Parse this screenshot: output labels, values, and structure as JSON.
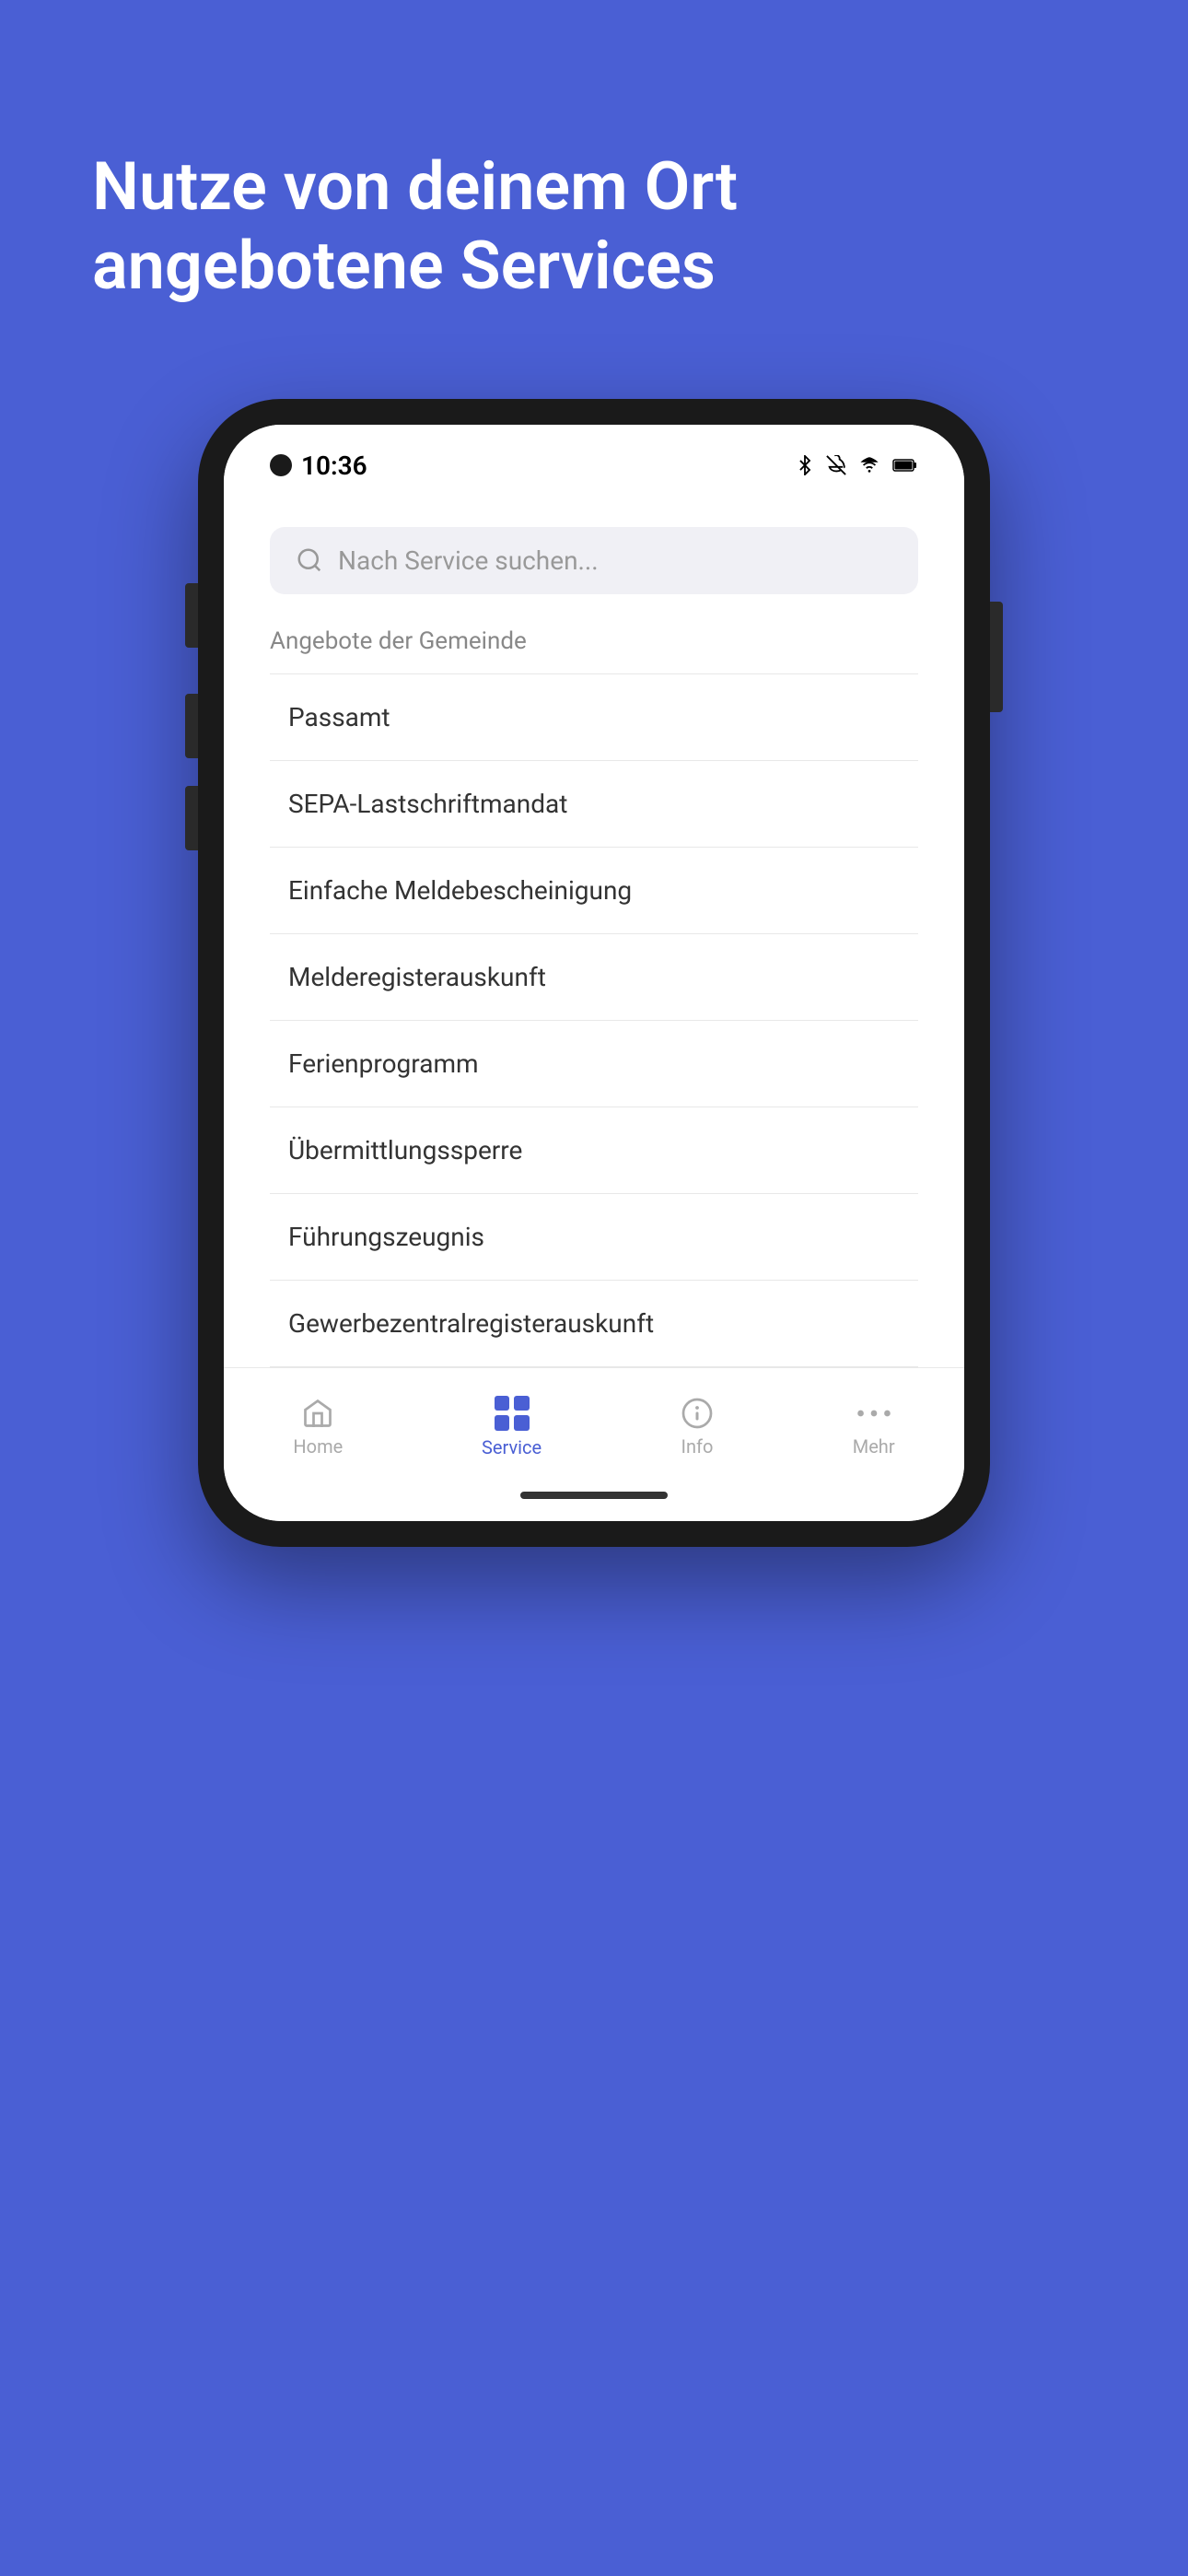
{
  "hero": {
    "title": "Nutze von deinem Ort angebotene Services",
    "background_color": "#4a5fd4"
  },
  "status_bar": {
    "time": "10:36",
    "icons": [
      "bluetooth",
      "bell-off",
      "wifi",
      "battery"
    ]
  },
  "search": {
    "placeholder": "Nach Service suchen..."
  },
  "section": {
    "title": "Angebote der Gemeinde"
  },
  "services": [
    {
      "label": "Passamt"
    },
    {
      "label": "SEPA-Lastschriftmandat"
    },
    {
      "label": "Einfache Meldebescheinigung"
    },
    {
      "label": "Melderegisterauskunft"
    },
    {
      "label": "Ferienprogramm"
    },
    {
      "label": "Übermittlungssperre"
    },
    {
      "label": "Führungszeugnis"
    },
    {
      "label": "Gewerbezentralregisterauskunft"
    }
  ],
  "nav": {
    "items": [
      {
        "label": "Home",
        "icon": "home",
        "active": false
      },
      {
        "label": "Service",
        "icon": "grid",
        "active": true
      },
      {
        "label": "Info",
        "icon": "info",
        "active": false
      },
      {
        "label": "Mehr",
        "icon": "more",
        "active": false
      }
    ]
  }
}
